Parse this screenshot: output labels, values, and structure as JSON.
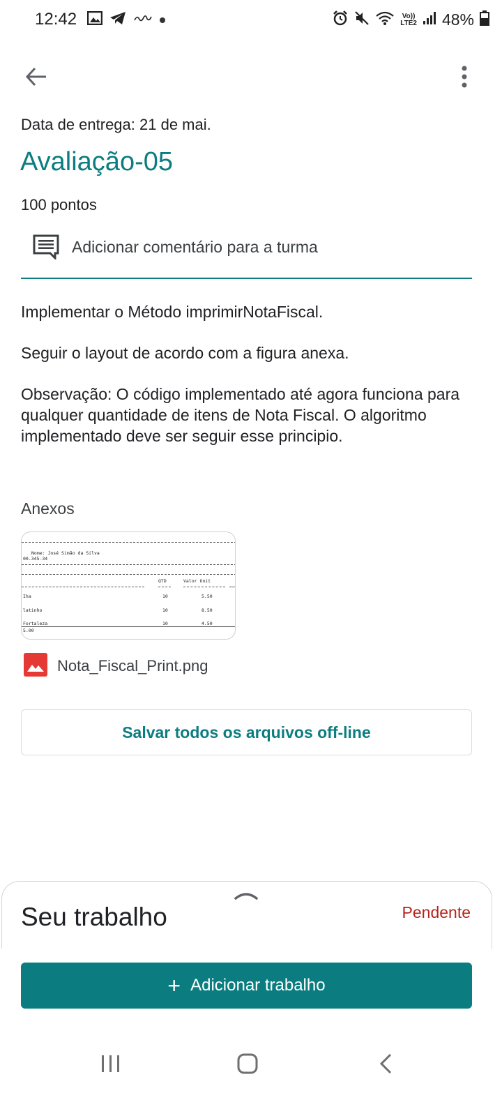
{
  "status_bar": {
    "time": "12:42",
    "battery": "48%",
    "lte_top": "Vo))",
    "lte_bottom": "LTE2",
    "left_icons": [
      "gallery-icon",
      "telegram-icon",
      "app-logo-icon",
      "notification-dot"
    ],
    "right_icons": [
      "alarm-icon",
      "mute-icon",
      "wifi-icon",
      "signal-icon",
      "battery-icon"
    ]
  },
  "assignment": {
    "due_date": "Data de entrega: 21 de mai.",
    "title": "Avaliação-05",
    "points": "100 pontos",
    "comment_label": "Adicionar comentário para a turma",
    "description": [
      "Implementar o Método imprimirNotaFiscal.",
      "Seguir o layout de acordo com a figura anexa.",
      "Observação: O código implementado até agora funciona para qualquer quantidade de itens de Nota Fiscal. O algoritmo implementado deve ser seguir esse principio."
    ]
  },
  "attachments": {
    "label": "Anexos",
    "preview": {
      "name_line": "Nome: José Simão da Silva",
      "id_line": "00.345-34",
      "col_qtd": "QTD",
      "col_valor": "Valor Unit",
      "rows": [
        {
          "item": "Iha",
          "qtd": "10",
          "valor": "5.50"
        },
        {
          "item": "latinho",
          "qtd": "10",
          "valor": "8.50"
        },
        {
          "item": "Fortaleza",
          "qtd": "10",
          "valor": "4.50"
        }
      ],
      "footer": "5.00"
    },
    "file_name": "Nota_Fiscal_Print.png",
    "save_all_label": "Salvar todos os arquivos off-line"
  },
  "your_work": {
    "title": "Seu trabalho",
    "status": "Pendente",
    "add_label": "Adicionar trabalho"
  },
  "colors": {
    "accent": "#0b7d80",
    "status_pending": "#b3261e",
    "text": "#202124"
  }
}
